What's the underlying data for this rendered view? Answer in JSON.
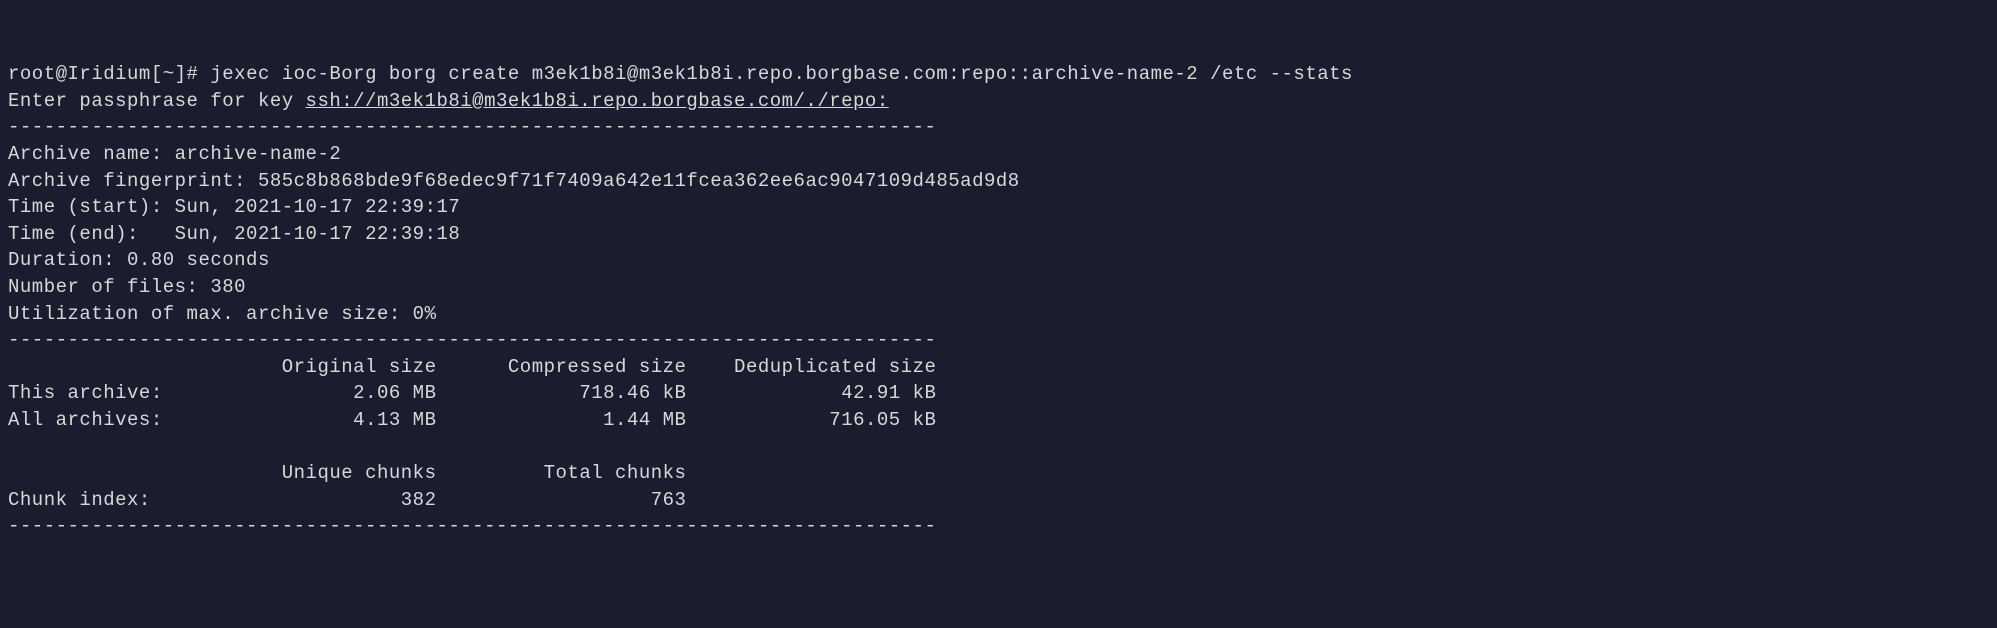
{
  "prompt": {
    "user_host": "root@Iridium",
    "path": "[~]",
    "symbol": "#",
    "command": "jexec ioc-Borg borg create m3ek1b8i@m3ek1b8i.repo.borgbase.com:repo::archive-name-2 /etc --stats"
  },
  "passphrase_line": {
    "prefix": "Enter passphrase for key ",
    "key_url": "ssh://m3ek1b8i@m3ek1b8i.repo.borgbase.com/./repo:"
  },
  "divider": "------------------------------------------------------------------------------",
  "archive": {
    "name_label": "Archive name:",
    "name_value": "archive-name-2",
    "fingerprint_label": "Archive fingerprint:",
    "fingerprint_value": "585c8b868bde9f68edec9f71f7409a642e11fcea362ee6ac9047109d485ad9d8",
    "time_start_label": "Time (start):",
    "time_start_value": "Sun, 2021-10-17 22:39:17",
    "time_end_label": "Time (end):",
    "time_end_value": "Sun, 2021-10-17 22:39:18",
    "duration_label": "Duration:",
    "duration_value": "0.80 seconds",
    "num_files_label": "Number of files:",
    "num_files_value": "380",
    "utilization_label": "Utilization of max. archive size:",
    "utilization_value": "0%"
  },
  "stats": {
    "header_original": "Original size",
    "header_compressed": "Compressed size",
    "header_deduplicated": "Deduplicated size",
    "this_archive_label": "This archive:",
    "this_archive_original": "2.06 MB",
    "this_archive_compressed": "718.46 kB",
    "this_archive_deduplicated": "42.91 kB",
    "all_archives_label": "All archives:",
    "all_archives_original": "4.13 MB",
    "all_archives_compressed": "1.44 MB",
    "all_archives_deduplicated": "716.05 kB",
    "unique_chunks_label": "Unique chunks",
    "total_chunks_label": "Total chunks",
    "chunk_index_label": "Chunk index:",
    "chunk_index_unique": "382",
    "chunk_index_total": "763"
  }
}
